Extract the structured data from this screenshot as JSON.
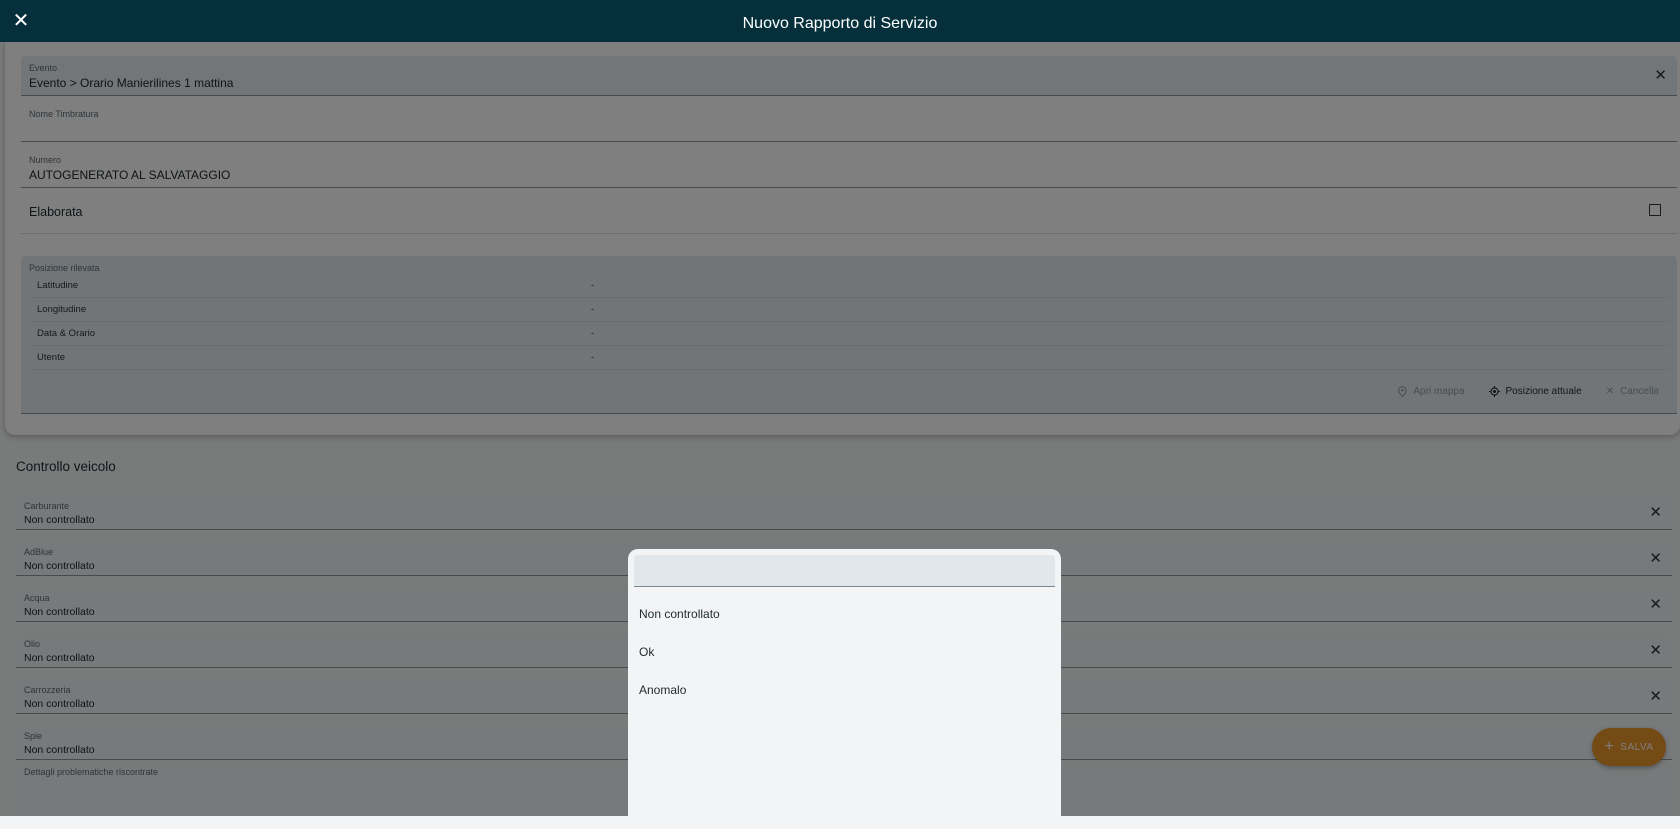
{
  "header": {
    "title": "Nuovo Rapporto di Servizio",
    "close_glyph": "✕"
  },
  "form": {
    "evento": {
      "label": "Evento",
      "value": "Evento > Orario Manierilines 1 mattina"
    },
    "nome_timbratura": {
      "label": "Nome Timbratura",
      "value": ""
    },
    "numero": {
      "label": "Numero",
      "value": "AUTOGENERATO AL SALVATAGGIO"
    },
    "elaborata": {
      "label": "Elaborata",
      "checked": false
    },
    "posizione": {
      "title": "Posizione rilevata",
      "rows": [
        {
          "label": "Latitudine",
          "value": "-"
        },
        {
          "label": "Longitudine",
          "value": "-"
        },
        {
          "label": "Data & Orario",
          "value": "-"
        },
        {
          "label": "Utente",
          "value": "-"
        }
      ],
      "actions": {
        "apri_mappa": "Apri mappa",
        "posizione_attuale": "Posizione attuale",
        "cancella": "Cancella"
      }
    }
  },
  "controllo": {
    "title": "Controllo veicolo",
    "fields": [
      {
        "label": "Carburante",
        "value": "Non controllato"
      },
      {
        "label": "AdBlue",
        "value": "Non controllato"
      },
      {
        "label": "Acqua",
        "value": "Non controllato"
      },
      {
        "label": "Olio",
        "value": "Non controllato"
      },
      {
        "label": "Carrozzeria",
        "value": "Non controllato"
      },
      {
        "label": "Spie",
        "value": "Non controllato"
      }
    ],
    "dettagli_label": "Dettagli problematiche riscontrate"
  },
  "fab": {
    "label": "SALVA",
    "icon": "plus-icon"
  },
  "dialog": {
    "search_value": "",
    "options": [
      "Non controllato",
      "Ok",
      "Anomalo"
    ]
  },
  "colors": {
    "header": "#062f3c",
    "accent": "#e8952a"
  }
}
